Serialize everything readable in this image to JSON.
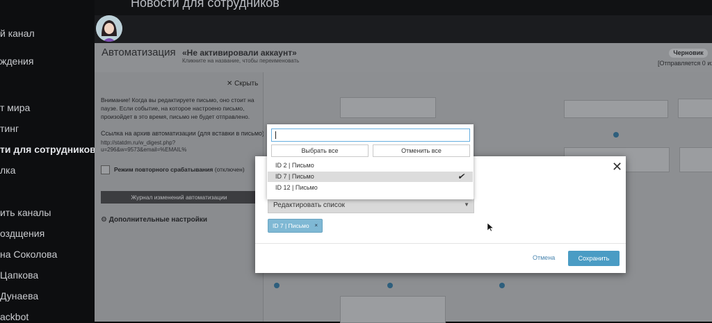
{
  "top_bar": {
    "title": "Новости для сотрудников"
  },
  "left_nav": {
    "items": [
      {
        "label": "й канал"
      },
      {
        "label": "ждения"
      },
      {
        "label": "т мира"
      },
      {
        "label": "тинг"
      },
      {
        "label": "ти для сотрудников"
      },
      {
        "label": "лка"
      },
      {
        "label": "ить каналы"
      },
      {
        "label": "оздщения"
      },
      {
        "label": "на Соколова"
      },
      {
        "label": "Цапкова"
      },
      {
        "label": "Дунаева"
      },
      {
        "label": "ackbot"
      }
    ]
  },
  "automation": {
    "title": "Автоматизация",
    "name": "«Не активировали аккаунт»",
    "name_hint": "Кликните на название, чтобы переименовать",
    "status_badge": "Черновик",
    "status_text": "[Отправляется 0 из"
  },
  "side_panel": {
    "hide_label": "Скрыть",
    "warning": "Внимание! Когда вы редактируете письмо, оно стоит на паузе. Если событие, на которое настроено письмо, произойдет в это время, письмо не будет отправлено.",
    "archive_label": "Ссылка на архив автоматизации (для вставки в письмо):",
    "archive_url": "http://statdm.ru/w_digest.php?u=296&w=9573&email=%EMAIL%",
    "repeat_label": "Режим повторного срабатывания",
    "repeat_state": "(отключен)",
    "journal_button": "Журнал изменений автоматизации",
    "more_settings": "Дополнительные настройки"
  },
  "modal": {
    "search_value": "",
    "select_all_label": "Выбрать все",
    "deselect_all_label": "Отменить все",
    "options": [
      {
        "label": "ID 2 | Письмо",
        "selected": false
      },
      {
        "label": "ID 7 | Письмо",
        "selected": true
      },
      {
        "label": "ID 12 | Письмо",
        "selected": false
      }
    ],
    "select_label": "Редактировать список",
    "selected_tag": "ID 7 | Письмо",
    "tag_remove": "×",
    "cancel_label": "Отмена",
    "save_label": "Сохранить"
  },
  "colors": {
    "accent": "#4a9cc4",
    "tag": "#7fb8d4",
    "focus_border": "#66aee0"
  }
}
